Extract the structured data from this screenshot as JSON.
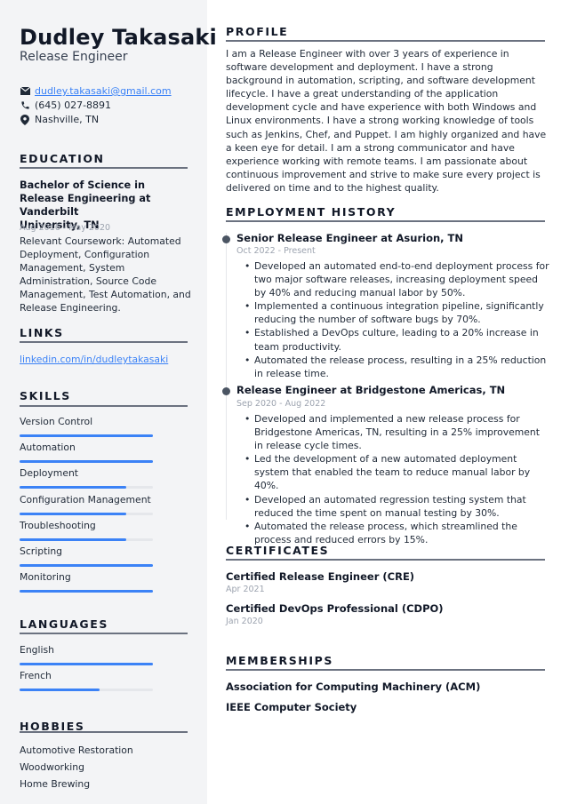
{
  "header": {
    "name": "Dudley Takasaki",
    "role": "Release Engineer"
  },
  "contact": {
    "email": "dudley.takasaki@gmail.com",
    "phone": "(645) 027-8891",
    "location": "Nashville, TN",
    "icons": [
      "envelope-icon",
      "phone-icon",
      "location-pin-icon"
    ]
  },
  "education": {
    "title": "EDUCATION",
    "degree_line1": "Bachelor of Science in",
    "degree_line2": "Release Engineering at Vanderbilt",
    "degree_line3": "University, TN",
    "dates": "Aug 2016 - May 2020",
    "coursework": "Relevant Coursework: Automated Deployment, Configuration Management, System Administration, Source Code Management, Test Automation, and Release Engineering."
  },
  "links": {
    "title": "LINKS",
    "items": [
      {
        "label": "linkedin.com/in/dudleytakasaki"
      }
    ]
  },
  "skills": {
    "title": "SKILLS",
    "items": [
      {
        "label": "Version Control",
        "level": 100
      },
      {
        "label": "Automation",
        "level": 100
      },
      {
        "label": "Deployment",
        "level": 80
      },
      {
        "label": "Configuration Management",
        "level": 80
      },
      {
        "label": "Troubleshooting",
        "level": 80
      },
      {
        "label": "Scripting",
        "level": 100
      },
      {
        "label": "Monitoring",
        "level": 100
      }
    ]
  },
  "languages": {
    "title": "LANGUAGES",
    "items": [
      {
        "label": "English",
        "level": 100
      },
      {
        "label": "French",
        "level": 60
      }
    ]
  },
  "hobbies": {
    "title": "HOBBIES",
    "items": [
      "Automotive Restoration",
      "Woodworking",
      "Home Brewing"
    ]
  },
  "profile": {
    "title": "PROFILE",
    "text": "I am a Release Engineer with over 3 years of experience in software development and deployment. I have a strong background in automation, scripting, and software development lifecycle. I have a great understanding of the application development cycle and have experience with both Windows and Linux environments. I have a strong working knowledge of tools such as Jenkins, Chef, and Puppet. I am highly organized and have a keen eye for detail. I am a strong communicator and have experience working with remote teams. I am passionate about continuous improvement and strive to make sure every project is delivered on time and to the highest quality."
  },
  "employment": {
    "title": "EMPLOYMENT HISTORY",
    "jobs": [
      {
        "title": "Senior Release Engineer at Asurion, TN",
        "dates": "Oct 2022 - Present",
        "bullets": [
          "Developed an automated end-to-end deployment process for two major software releases, increasing deployment speed by 40% and reducing manual labor by 50%.",
          "Implemented a continuous integration pipeline, significantly reducing the number of software bugs by 70%.",
          "Established a DevOps culture, leading to a 20% increase in team productivity.",
          "Automated the release process, resulting in a 25% reduction in release time."
        ]
      },
      {
        "title": "Release Engineer at Bridgestone Americas, TN",
        "dates": "Sep 2020 - Aug 2022",
        "bullets": [
          "Developed and implemented a new release process for Bridgestone Americas, TN, resulting in a 25% improvement in release cycle times.",
          "Led the development of a new automated deployment system that enabled the team to reduce manual labor by 40%.",
          "Developed an automated regression testing system that reduced the time spent on manual testing by 30%.",
          "Automated the release process, which streamlined the process and reduced errors by 15%."
        ]
      }
    ]
  },
  "certificates": {
    "title": "CERTIFICATES",
    "items": [
      {
        "name": "Certified Release Engineer (CRE)",
        "date": "Apr 2021"
      },
      {
        "name": "Certified DevOps Professional (CDPO)",
        "date": "Jan 2020"
      }
    ]
  },
  "memberships": {
    "title": "MEMBERSHIPS",
    "items": [
      "Association for Computing Machinery (ACM)",
      "IEEE Computer Society"
    ]
  },
  "colors": {
    "accent": "#3b82f6",
    "sidebar_bg": "#f3f4f6",
    "text": "#1f2937",
    "muted": "#9ca3af"
  }
}
